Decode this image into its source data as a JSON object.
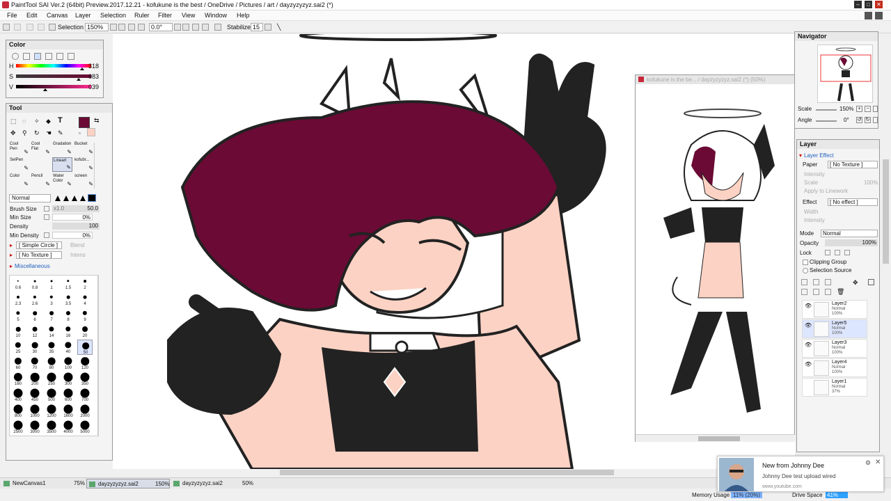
{
  "window": {
    "title": "PaintTool SAI Ver.2 (64bit) Preview.2017.12.21 - kofukune is the best / OneDrive / Pictures / art / dayzyzyzyz.sai2 (*)",
    "minimize": "–",
    "maximize": "□",
    "close": "✕"
  },
  "menu": [
    "File",
    "Edit",
    "Canvas",
    "Layer",
    "Selection",
    "Ruler",
    "Filter",
    "View",
    "Window",
    "Help"
  ],
  "toolbar": {
    "selection_label": "Selection",
    "zoom": "150%",
    "rotation": "0.0°",
    "stabilizer_label": "Stabilizer",
    "stabilizer_value": "15"
  },
  "color_panel": {
    "title": "Color",
    "h_label": "H",
    "h_value": "318",
    "s_label": "S",
    "s_value": "083",
    "v_label": "V",
    "v_value": "039",
    "h_fraction": 0.88,
    "s_fraction": 0.83,
    "v_fraction": 0.39,
    "current_color": "#6b0a35"
  },
  "tool_panel": {
    "title": "Tool",
    "tools": [
      {
        "label": "Cool Pen"
      },
      {
        "label": "Cool Flat"
      },
      {
        "label": "Gradation"
      },
      {
        "label": "Bucket"
      },
      {
        "label": "SelPen"
      },
      {
        "label": "",
        "empty": true
      },
      {
        "label": "Lineart"
      },
      {
        "label": "kofubr..."
      },
      {
        "label": "Color"
      },
      {
        "label": "Pencil"
      },
      {
        "label": "Water Color"
      },
      {
        "label": "screen"
      }
    ],
    "blend_mode": "Normal",
    "brush_size_label": "Brush Size",
    "brush_size_mult": "x1.0",
    "brush_size_value": "50.0",
    "min_size_label": "Min Size",
    "min_size_value": "0%",
    "density_label": "Density",
    "density_value": "100",
    "min_density_label": "Min Density",
    "min_density_value": "0%",
    "shape": "[ Simple Circle ]",
    "shape_extra": "Blend",
    "texture": "[ No Texture ]",
    "texture_extra": "Intens",
    "misc_label": "Miscellaneous",
    "brush_sizes": [
      "0.6",
      "0.8",
      "1",
      "1.5",
      "2",
      "2.3",
      "2.6",
      "3",
      "3.5",
      "4",
      "5",
      "6",
      "7",
      "8",
      "9",
      "10",
      "12",
      "14",
      "16",
      "20",
      "25",
      "30",
      "35",
      "40",
      "50",
      "60",
      "70",
      "80",
      "100",
      "120",
      "160",
      "200",
      "250",
      "300",
      "350",
      "400",
      "450",
      "500",
      "600",
      "700",
      "800",
      "1000",
      "1200",
      "1600",
      "2000",
      "2500",
      "3000",
      "3500",
      "4000",
      "5000"
    ],
    "selected_size": "50"
  },
  "navigator": {
    "title": "Navigator",
    "scale_label": "Scale",
    "scale_value": "150%",
    "angle_label": "Angle",
    "angle_value": "0°"
  },
  "layer_panel": {
    "title": "Layer",
    "effect_label": "Layer Effect",
    "paper_label": "Paper",
    "paper_value": "[ No Texture ]",
    "intensity_label": "Intensity",
    "scale_label": "Scale",
    "scale_value": "100%",
    "apply_label": "Apply to Linework",
    "effect2_label": "Effect",
    "effect2_value": "[ No effect ]",
    "width_label": "Width",
    "intensity2_label": "Intensity",
    "mode_label": "Mode",
    "mode_value": "Normal",
    "opacity_label": "Opacity",
    "opacity_value": "100%",
    "lock_label": "Lock",
    "clipping_label": "Clipping Group",
    "selection_source_label": "Selection Source",
    "layers": [
      {
        "name": "Layer2",
        "mode": "Normal",
        "opacity": "100%",
        "visible": true,
        "selected": false
      },
      {
        "name": "Layer5",
        "mode": "Normal",
        "opacity": "100%",
        "visible": true,
        "selected": true
      },
      {
        "name": "Layer3",
        "mode": "Normal",
        "opacity": "100%",
        "visible": true,
        "selected": false
      },
      {
        "name": "Layer4",
        "mode": "Normal",
        "opacity": "100%",
        "visible": true,
        "selected": false
      },
      {
        "name": "Layer1",
        "mode": "Normal",
        "opacity": "37%",
        "visible": false,
        "selected": false
      }
    ]
  },
  "subview": {
    "title": "kofukune is the be... / dayzyzyzyz.sai2 (*) (50%)"
  },
  "tabs": [
    {
      "label": "NewCanvas1",
      "zoom": "75%"
    },
    {
      "label": "dayzyzyzyz.sai2",
      "zoom": "150%",
      "active": true
    },
    {
      "label": "dayzyzyzyz.sai2",
      "zoom": "50%"
    }
  ],
  "status": {
    "memory_label": "Memory Usage",
    "memory_value": "11% (20%)",
    "drive_label": "Drive Space",
    "drive_value": "41%"
  },
  "notification": {
    "title": "New from Johnny Dee",
    "body": "Johnny Dee test upload wired",
    "source": "www.youtube.com"
  },
  "colors": {
    "hair": "#6b0a35",
    "skin": "#fcd2c4",
    "black": "#222222",
    "accent_selected": "#dde6ff"
  }
}
